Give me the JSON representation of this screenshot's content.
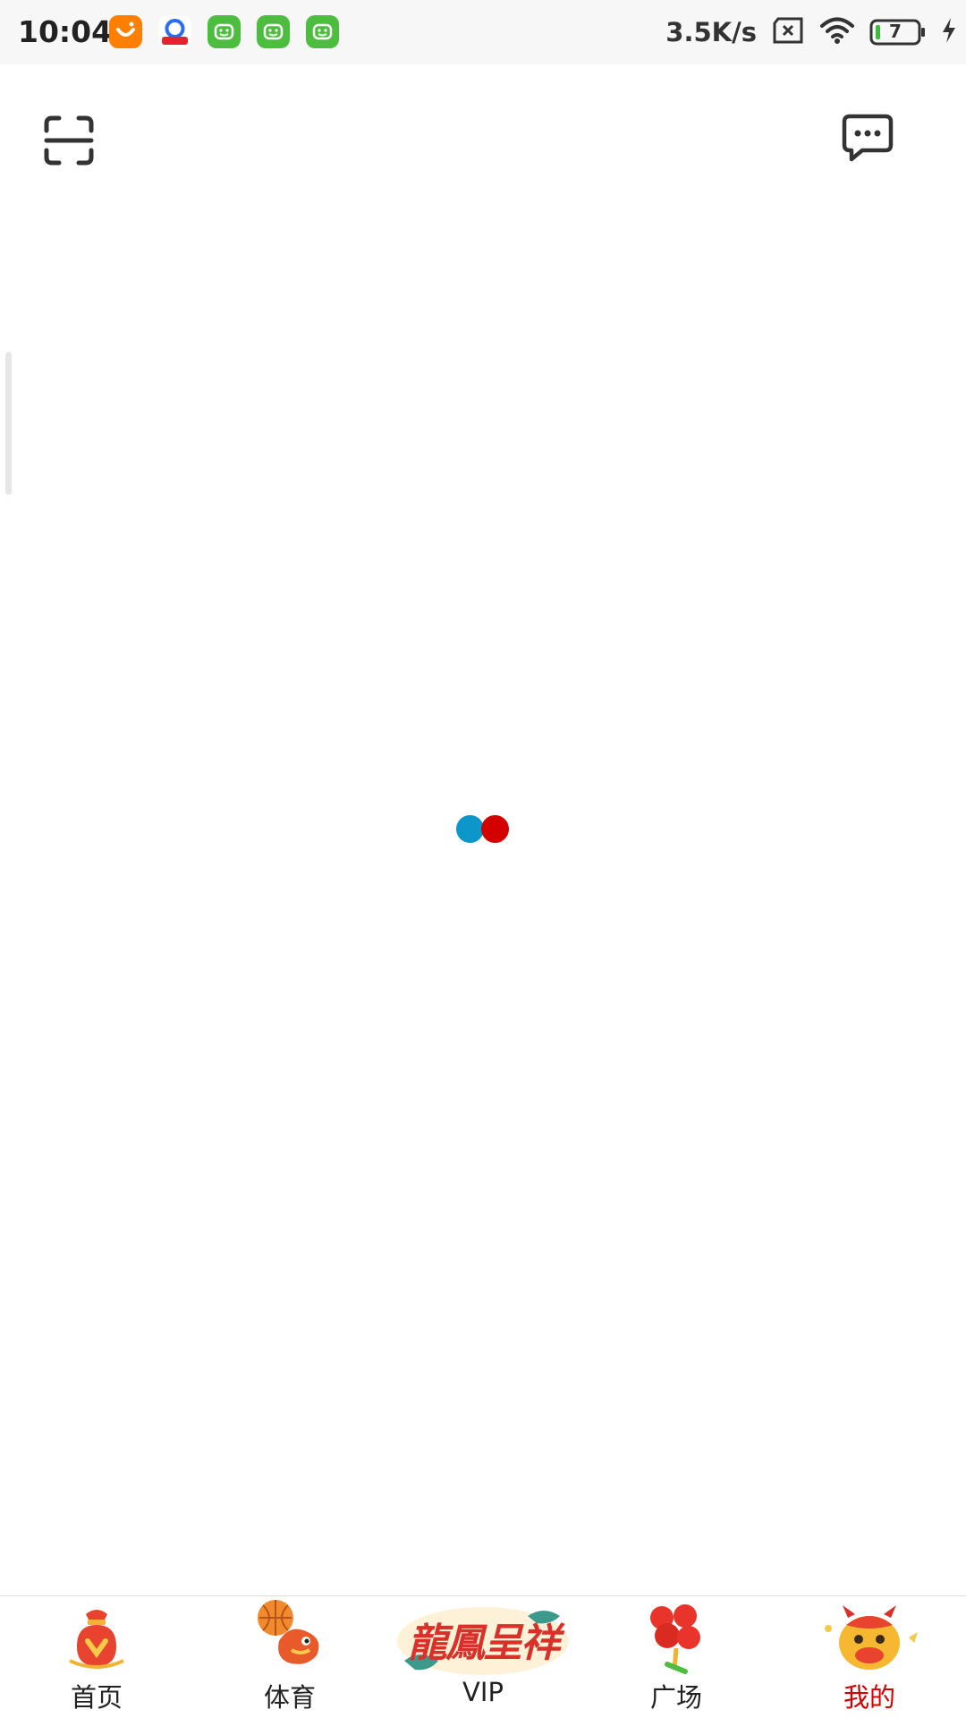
{
  "status_bar": {
    "time": "10:04",
    "net_speed": "3.5K/s",
    "battery_level": "7",
    "app_icons": [
      "taobao-icon",
      "uc-browser-icon",
      "green-app-icon",
      "green-app-icon",
      "green-app-icon"
    ],
    "status_icons": [
      "sim-x-icon",
      "wifi-icon",
      "battery-icon",
      "charging-bolt-icon"
    ]
  },
  "top_bar": {
    "left_icon": "scan-icon",
    "right_icon": "message-icon"
  },
  "loader": {
    "colors": [
      "#0d96c9",
      "#d40000"
    ]
  },
  "tab_bar": {
    "active_color": "#d40000",
    "tabs": [
      {
        "label": "首页",
        "icon": "lucky-bag-icon"
      },
      {
        "label": "体育",
        "icon": "basketball-dragon-icon"
      },
      {
        "label": "VIP",
        "icon": "dragon-phoenix-banner-icon",
        "banner_text": "龍鳳呈祥"
      },
      {
        "label": "广场",
        "icon": "firecracker-icon"
      },
      {
        "label": "我的",
        "icon": "ox-mascot-icon",
        "active": true
      }
    ]
  }
}
